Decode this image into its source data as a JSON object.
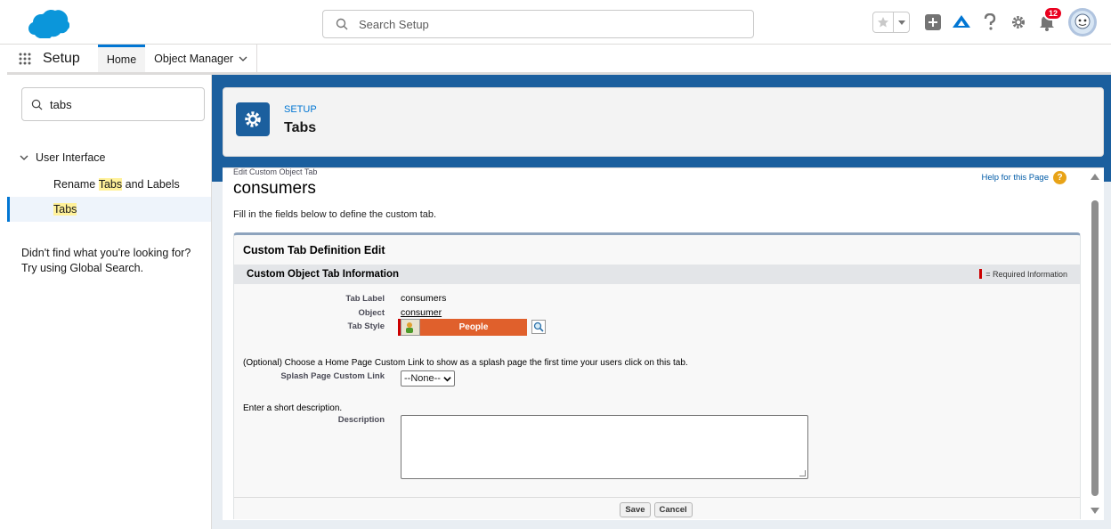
{
  "header": {
    "search_placeholder": "Search Setup",
    "notification_count": "12",
    "icons": [
      "salesforce-cloud-logo",
      "favorites-star-icon",
      "favorites-list-icon",
      "global-actions-icon",
      "trailhead-icon",
      "help-icon",
      "setup-gear-icon",
      "notifications-bell-icon",
      "user-avatar"
    ]
  },
  "nav": {
    "app_name": "Setup",
    "tabs": [
      {
        "label": "Home"
      },
      {
        "label": "Object Manager"
      }
    ]
  },
  "sidebar": {
    "quickfind_value": "tabs",
    "group": "User Interface",
    "items": [
      {
        "prefix": "Rename ",
        "highlight": "Tabs",
        "suffix": " and Labels"
      },
      {
        "prefix": "",
        "highlight": "Tabs",
        "suffix": ""
      }
    ],
    "not_found_line1": "Didn't find what you're looking for?",
    "not_found_line2": "Try using Global Search."
  },
  "page_header": {
    "eyebrow": "SETUP",
    "title": "Tabs"
  },
  "content": {
    "eyebrow": "Edit Custom Object Tab",
    "record_title": "consumers",
    "help_link": "Help for this Page",
    "intro": "Fill in the fields below to define the custom tab.",
    "block_title": "Custom Tab Definition Edit",
    "section_title": "Custom Object Tab Information",
    "required_legend": "= Required Information",
    "fields": {
      "tab_label_label": "Tab Label",
      "tab_label_value": "consumers",
      "object_label": "Object",
      "object_value": "consumer",
      "tab_style_label": "Tab Style",
      "tab_style_value": "People"
    },
    "optional_text": "(Optional) Choose a Home Page Custom Link to show as a splash page the first time your users click on this tab.",
    "splash_label": "Splash Page Custom Link",
    "splash_value": "--None--",
    "desc_prompt": "Enter a short description.",
    "desc_label": "Description",
    "save_label": "Save",
    "cancel_label": "Cancel"
  },
  "colors": {
    "brand_blue": "#0176d3",
    "setup_blue": "#1b5f9e",
    "tab_style_orange": "#e0602c",
    "required_red": "#cc0000"
  }
}
